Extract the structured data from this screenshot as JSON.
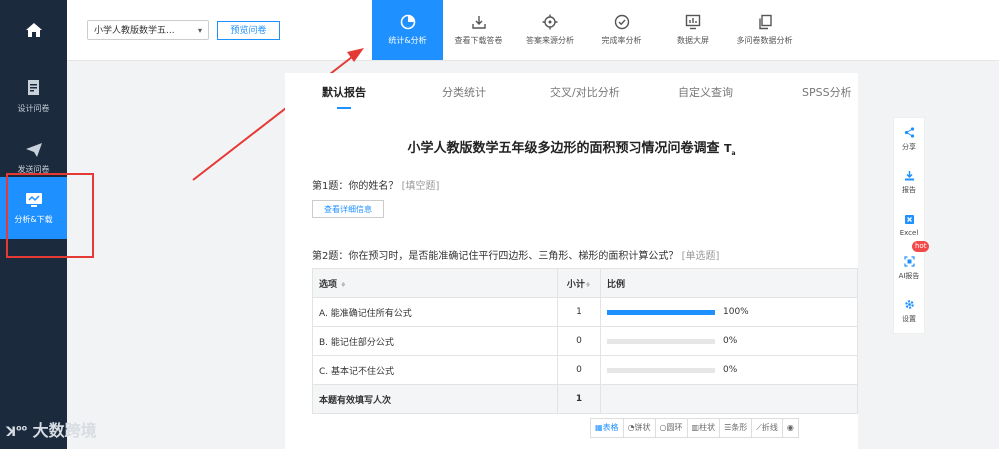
{
  "sidebar": {
    "home_icon": "home-icon",
    "items": [
      {
        "label": "设计问卷",
        "icon": "edit-doc-icon"
      },
      {
        "label": "发送问卷",
        "icon": "paper-plane-icon"
      },
      {
        "label": "分析&下载",
        "icon": "analytics-icon"
      }
    ]
  },
  "topbar": {
    "survey_select": "小学人教版数学五...",
    "preview_button": "预览问卷",
    "tabs": [
      {
        "label": "统计&分析",
        "icon": "pie-chart-icon"
      },
      {
        "label": "查看下载答卷",
        "icon": "download-box-icon"
      },
      {
        "label": "答案来源分析",
        "icon": "target-icon"
      },
      {
        "label": "完成率分析",
        "icon": "check-circle-icon"
      },
      {
        "label": "数据大屏",
        "icon": "monitor-chart-icon"
      },
      {
        "label": "多问卷数据分析",
        "icon": "multi-doc-icon"
      }
    ]
  },
  "subtabs": [
    "默认报告",
    "分类统计",
    "交叉/对比分析",
    "自定义查询",
    "SPSS分析"
  ],
  "report": {
    "title": "小学人教版数学五年级多边形的面积预习情况问卷调查",
    "title_icon": "text-format-icon",
    "q1": {
      "title": "第1题：你的姓名？",
      "type": "[填空题]",
      "detail_button": "查看详细信息"
    },
    "q2": {
      "title": "第2题：你在预习时，是否能准确记住平行四边形、三角形、梯形的面积计算公式？",
      "type": "[单选题]",
      "headers": {
        "option": "选项",
        "count": "小计",
        "ratio": "比例"
      },
      "rows": [
        {
          "option": "A. 能准确记住所有公式",
          "count": "1",
          "percent": "100%",
          "ratio": 1.0
        },
        {
          "option": "B. 能记住部分公式",
          "count": "0",
          "percent": "0%",
          "ratio": 0
        },
        {
          "option": "C. 基本记不住公式",
          "count": "0",
          "percent": "0%",
          "ratio": 0
        }
      ],
      "total": {
        "label": "本题有效填写人次",
        "count": "1"
      }
    },
    "chart_types": [
      "表格",
      "饼状",
      "圆环",
      "柱状",
      "条形",
      "折线"
    ]
  },
  "right_panel": [
    {
      "label": "分享",
      "icon": "share-icon"
    },
    {
      "label": "报告",
      "icon": "download-icon"
    },
    {
      "label": "Excel",
      "icon": "excel-icon"
    },
    {
      "label": "AI报告",
      "icon": "ai-scan-icon",
      "badge": "hot"
    },
    {
      "label": "设置",
      "icon": "gear-icon"
    }
  ],
  "watermark": "大数跨境",
  "colors": {
    "accent": "#1e90ff",
    "sidebar": "#1b2a3d",
    "highlight": "#e53935",
    "badge": "#f04a4a"
  }
}
